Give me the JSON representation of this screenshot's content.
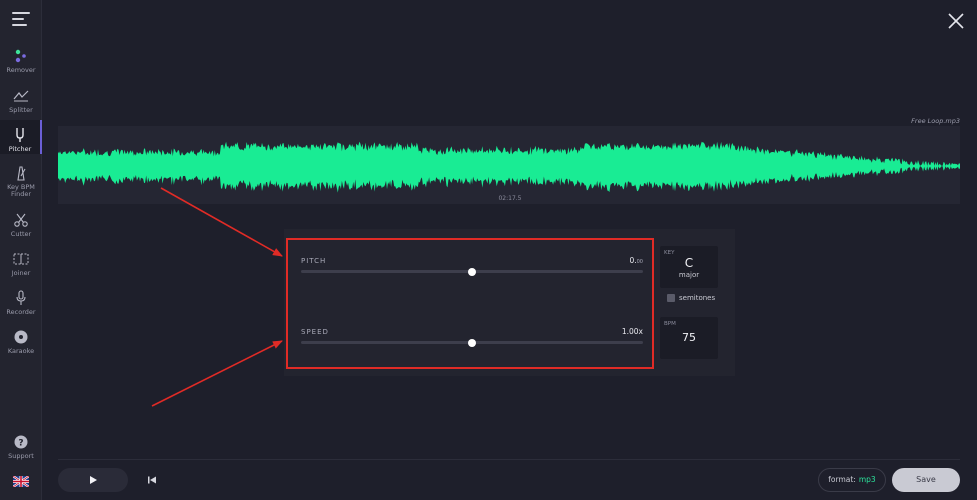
{
  "sidebar": {
    "items": [
      {
        "label": "Remover"
      },
      {
        "label": "Splitter"
      },
      {
        "label": "Pitcher"
      },
      {
        "label": "Key BPM Finder"
      },
      {
        "label": "Cutter"
      },
      {
        "label": "Joiner"
      },
      {
        "label": "Recorder"
      },
      {
        "label": "Karaoke"
      }
    ],
    "support": "Support",
    "language_icon": "uk-flag-icon",
    "active_item": "Pitcher"
  },
  "track": {
    "filename": "Free Loop.mp3",
    "time": "02:17.5",
    "waveform_color": "#19ec94"
  },
  "pitch": {
    "label": "PITCH",
    "value_main": "0.",
    "value_sub": "00",
    "position": 0.5
  },
  "speed": {
    "label": "SPEED",
    "value": "1.00x",
    "position": 0.5
  },
  "key": {
    "label": "KEY",
    "note": "C",
    "mode": "major"
  },
  "semitones": {
    "label": "semitones",
    "checked": false
  },
  "bpm": {
    "label": "BPM",
    "value": "75"
  },
  "footer": {
    "format_label": "format:",
    "format_value": "mp3",
    "save_label": "Save"
  },
  "colors": {
    "accent_green": "#19ec94",
    "highlight_red": "#e02b26",
    "background": "#1e1f2b"
  }
}
